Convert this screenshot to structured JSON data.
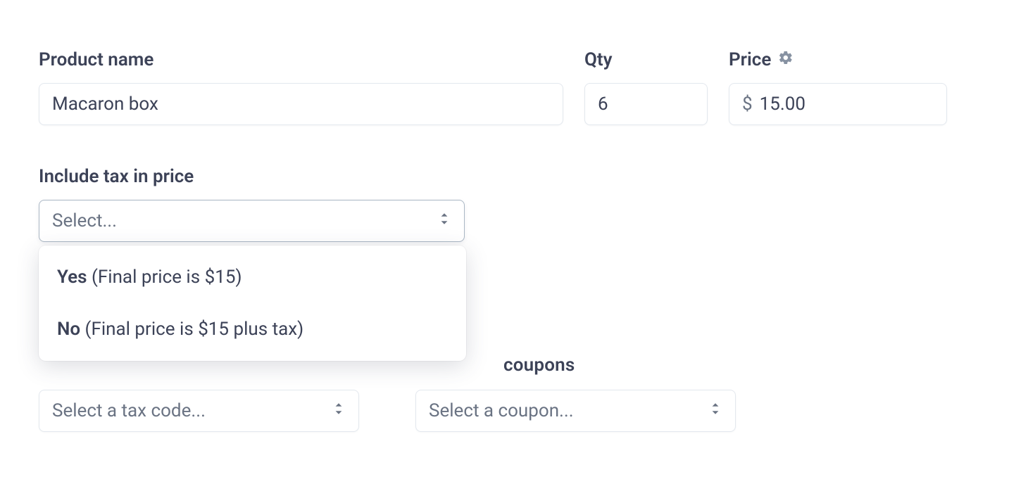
{
  "labels": {
    "product_name": "Product name",
    "qty": "Qty",
    "price": "Price",
    "include_tax": "Include tax in price",
    "coupons_partial": "coupons"
  },
  "form": {
    "product_name": "Macaron box",
    "qty": "6",
    "price_currency": "$",
    "price_value": "15.00"
  },
  "include_tax_select": {
    "placeholder": "Select...",
    "options": [
      {
        "strong": "Yes",
        "rest": " (Final price is $15)"
      },
      {
        "strong": "No",
        "rest": " (Final price is $15 plus tax)"
      }
    ]
  },
  "tax_code_select": {
    "placeholder": "Select a tax code..."
  },
  "coupon_select": {
    "placeholder": "Select a coupon..."
  }
}
